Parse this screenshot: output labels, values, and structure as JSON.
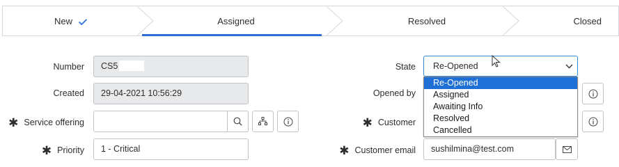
{
  "process_flow": {
    "steps": [
      {
        "label": "New",
        "state": "completed"
      },
      {
        "label": "Assigned",
        "state": "active"
      },
      {
        "label": "Resolved",
        "state": "pending"
      },
      {
        "label": "Closed",
        "state": "pending"
      }
    ],
    "accent_color": "#2b6fd6"
  },
  "form": {
    "number": {
      "label": "Number",
      "value": "CS5"
    },
    "created": {
      "label": "Created",
      "value": "29-04-2021 10:56:29"
    },
    "service_offering": {
      "label": "Service offering",
      "value": ""
    },
    "priority": {
      "label": "Priority",
      "value": "1 - Critical"
    },
    "state": {
      "label": "State",
      "value": "Re-Opened",
      "options": [
        "Re-Opened",
        "Assigned",
        "Awaiting Info",
        "Resolved",
        "Cancelled"
      ],
      "selected_index": 0
    },
    "opened_by": {
      "label": "Opened by"
    },
    "customer": {
      "label": "Customer"
    },
    "customer_email": {
      "label": "Customer email",
      "value": "sushilmina@test.com"
    }
  }
}
